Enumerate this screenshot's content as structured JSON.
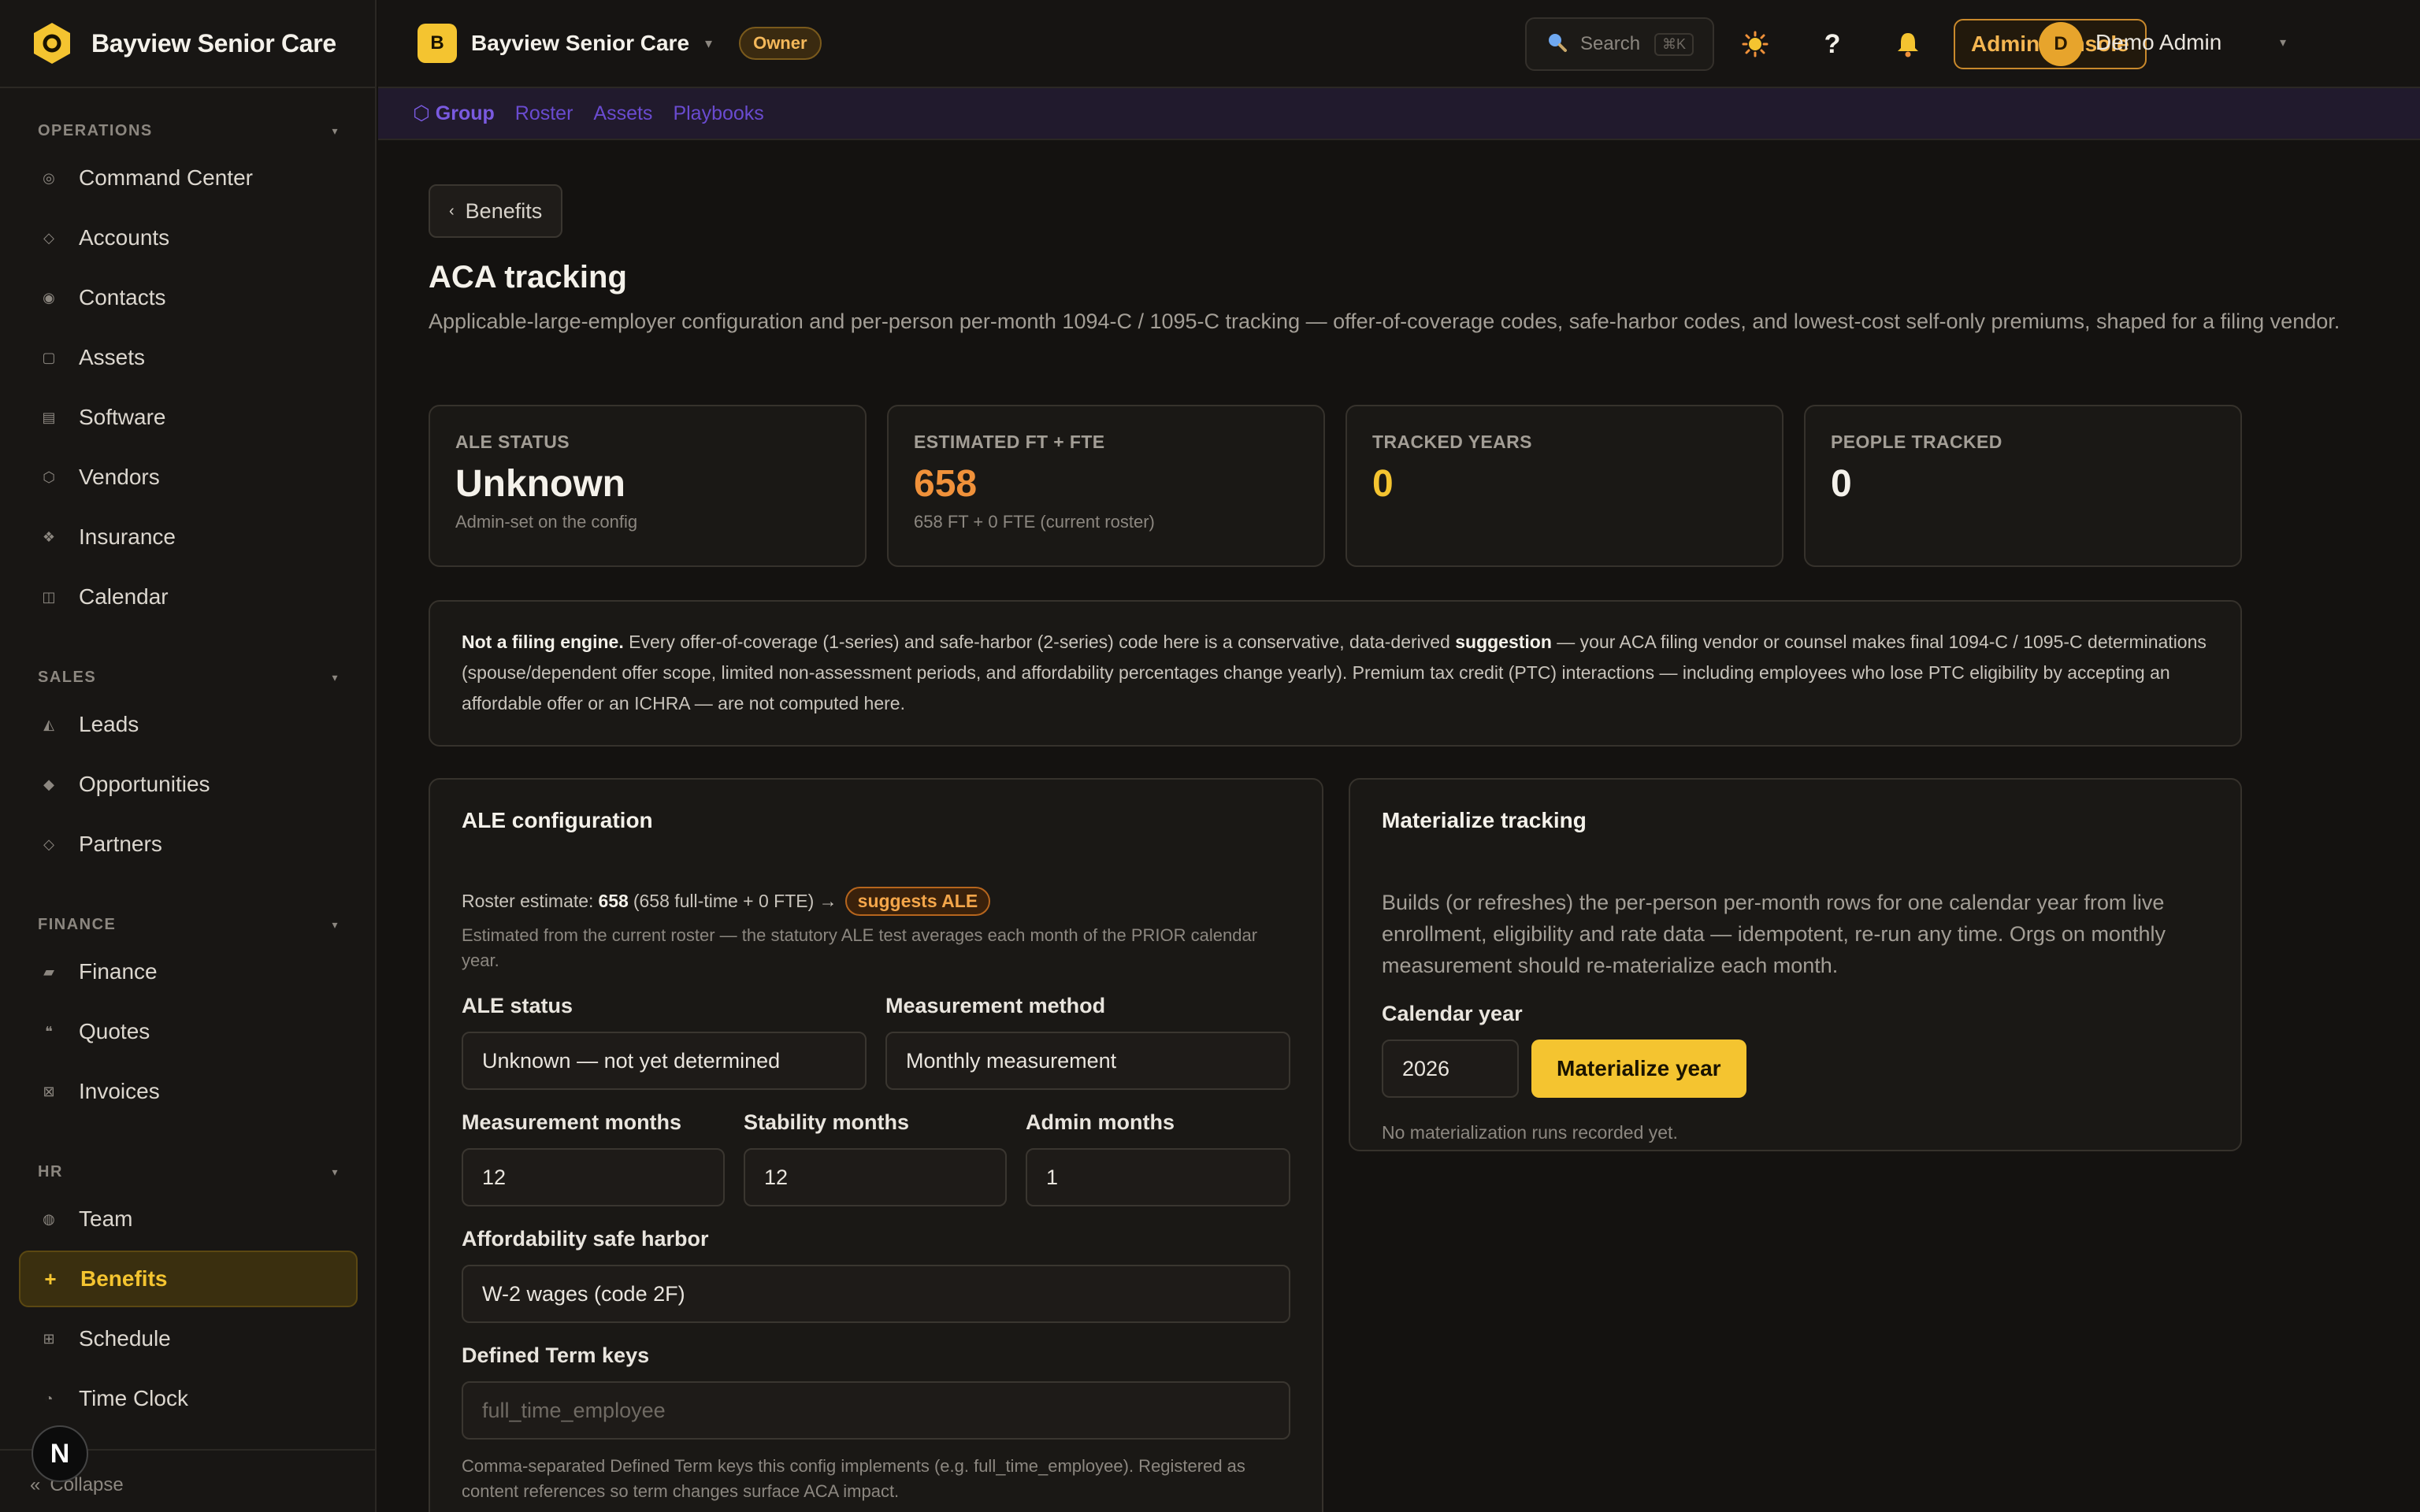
{
  "brand": {
    "name": "Bayview Senior Care"
  },
  "sidebar": {
    "sections": [
      {
        "title": "OPERATIONS",
        "items": [
          {
            "label": "Command Center",
            "icon": "◎"
          },
          {
            "label": "Accounts",
            "icon": "◇"
          },
          {
            "label": "Contacts",
            "icon": "◉"
          },
          {
            "label": "Assets",
            "icon": "▢"
          },
          {
            "label": "Software",
            "icon": "▤"
          },
          {
            "label": "Vendors",
            "icon": "⬡"
          },
          {
            "label": "Insurance",
            "icon": "❖"
          },
          {
            "label": "Calendar",
            "icon": "◫"
          }
        ]
      },
      {
        "title": "SALES",
        "items": [
          {
            "label": "Leads",
            "icon": "◭"
          },
          {
            "label": "Opportunities",
            "icon": "◆"
          },
          {
            "label": "Partners",
            "icon": "◇"
          }
        ]
      },
      {
        "title": "FINANCE",
        "items": [
          {
            "label": "Finance",
            "icon": "▰"
          },
          {
            "label": "Quotes",
            "icon": "❝"
          },
          {
            "label": "Invoices",
            "icon": "⊠"
          }
        ]
      },
      {
        "title": "HR",
        "items": [
          {
            "label": "Team",
            "icon": "◍"
          },
          {
            "label": "Benefits",
            "icon": "+",
            "active": true
          },
          {
            "label": "Schedule",
            "icon": "⊞"
          },
          {
            "label": "Time Clock",
            "icon": "◔"
          }
        ]
      }
    ],
    "collapse_label": "Collapse",
    "dev_badge": "N"
  },
  "topbar": {
    "org_initial": "B",
    "org_name": "Bayview Senior Care",
    "role_badge": "Owner",
    "search_placeholder": "Search",
    "search_shortcut": "⌘K",
    "admin_console_label": "Admin console",
    "user_initial": "D",
    "user_name": "Demo Admin"
  },
  "subtabs": [
    {
      "label": "⬡ Group",
      "active": true
    },
    {
      "label": "Roster"
    },
    {
      "label": "Assets"
    },
    {
      "label": "Playbooks"
    }
  ],
  "page": {
    "back_label": "Benefits",
    "title": "ACA tracking",
    "description": "Applicable-large-employer configuration and per-person per-month 1094-C / 1095-C tracking — offer-of-coverage codes, safe-harbor codes, and lowest-cost self-only premiums, shaped for a filing vendor."
  },
  "stats": [
    {
      "label": "ALE STATUS",
      "value": "Unknown",
      "sub": "Admin-set on the config",
      "color": "white"
    },
    {
      "label": "ESTIMATED FT + FTE",
      "value": "658",
      "sub": "658 FT + 0 FTE (current roster)",
      "color": "orange"
    },
    {
      "label": "TRACKED YEARS",
      "value": "0",
      "sub": "",
      "color": "yellow"
    },
    {
      "label": "PEOPLE TRACKED",
      "value": "0",
      "sub": "",
      "color": "white"
    }
  ],
  "notice": {
    "lead": "Not a filing engine.",
    "part1": " Every offer-of-coverage (1-series) and safe-harbor (2-series) code here is a conservative, data-derived ",
    "bold2": "suggestion",
    "part2": " — your ACA filing vendor or counsel makes final 1094-C / 1095-C determinations (spouse/dependent offer scope, limited non-assessment periods, and affordability percentages change yearly). Premium tax credit (PTC) interactions — including employees who lose PTC eligibility by accepting an affordable offer or an ICHRA — are not computed here."
  },
  "ale_config": {
    "title": "ALE configuration",
    "roster_prefix": "Roster estimate:",
    "roster_value": "658",
    "roster_suffix": "(658 full-time + 0 FTE) →",
    "suggest_badge": "suggests ALE",
    "roster_hint": "Estimated from the current roster — the statutory ALE test averages each month of the PRIOR calendar year.",
    "ale_status_label": "ALE status",
    "ale_status_value": "Unknown — not yet determined",
    "measurement_method_label": "Measurement method",
    "measurement_method_value": "Monthly measurement",
    "measurement_months_label": "Measurement months",
    "measurement_months_value": "12",
    "stability_months_label": "Stability months",
    "stability_months_value": "12",
    "admin_months_label": "Admin months",
    "admin_months_value": "1",
    "safe_harbor_label": "Affordability safe harbor",
    "safe_harbor_value": "W-2 wages (code 2F)",
    "term_keys_label": "Defined Term keys",
    "term_keys_placeholder": "full_time_employee",
    "term_keys_hint": "Comma-separated Defined Term keys this config implements (e.g. full_time_employee). Registered as content references so term changes surface ACA impact."
  },
  "materialize": {
    "title": "Materialize tracking",
    "description": "Builds (or refreshes) the per-person per-month rows for one calendar year from live enrollment, eligibility and rate data — idempotent, re-run any time. Orgs on monthly measurement should re-materialize each month.",
    "year_label": "Calendar year",
    "year_value": "2026",
    "button_label": "Materialize year",
    "status": "No materialization runs recorded yet."
  }
}
